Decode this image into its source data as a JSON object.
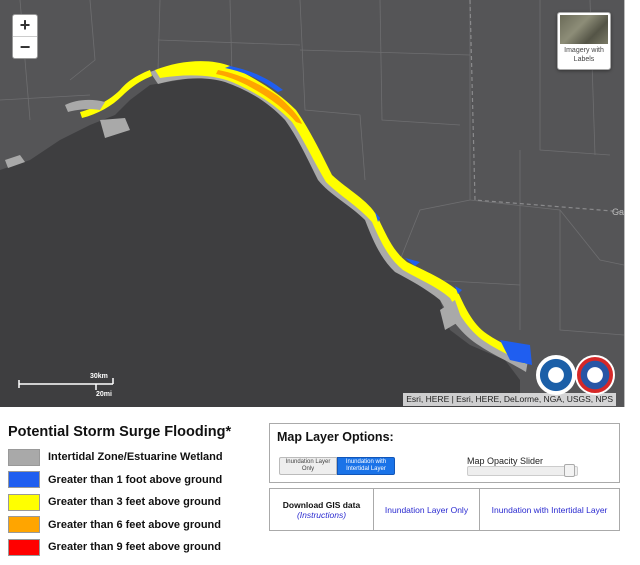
{
  "map": {
    "zoom_in": "+",
    "zoom_out": "−",
    "basemap_toggle_label": "Imagery with Labels",
    "scale_km": "30km",
    "scale_mi": "20mi",
    "attribution": "Esri, HERE | Esri, HERE, DeLorme, NGA, USGS, NPS",
    "state_label": "Ga",
    "colors": {
      "water": "#3e3e40",
      "land": "#5a5a5c",
      "borders": "#7a7a7c"
    }
  },
  "legend": {
    "title": "Potential Storm Surge Flooding*",
    "items": [
      {
        "label": "Intertidal Zone/Estuarine Wetland",
        "color": "#a9a9a9"
      },
      {
        "label": "Greater than 1 foot above ground",
        "color": "#1f5ef0"
      },
      {
        "label": "Greater than 3 feet above ground",
        "color": "#ffff00"
      },
      {
        "label": "Greater than 6 feet above ground",
        "color": "#ffa500"
      },
      {
        "label": "Greater than 9 feet above ground",
        "color": "#ff0000"
      }
    ]
  },
  "options": {
    "title": "Map Layer Options:",
    "toggle_off": "Inundation Layer Only",
    "toggle_on": "Inundation with Intertidal Layer",
    "slider_label": "Map Opacity Slider",
    "opacity": 0.95
  },
  "downloads": {
    "gis_title": "Download GIS data",
    "gis_instructions": "(Instructions)",
    "inundation_only": "Inundation Layer Only",
    "inundation_intertidal": "Inundation with Intertidal Layer"
  }
}
